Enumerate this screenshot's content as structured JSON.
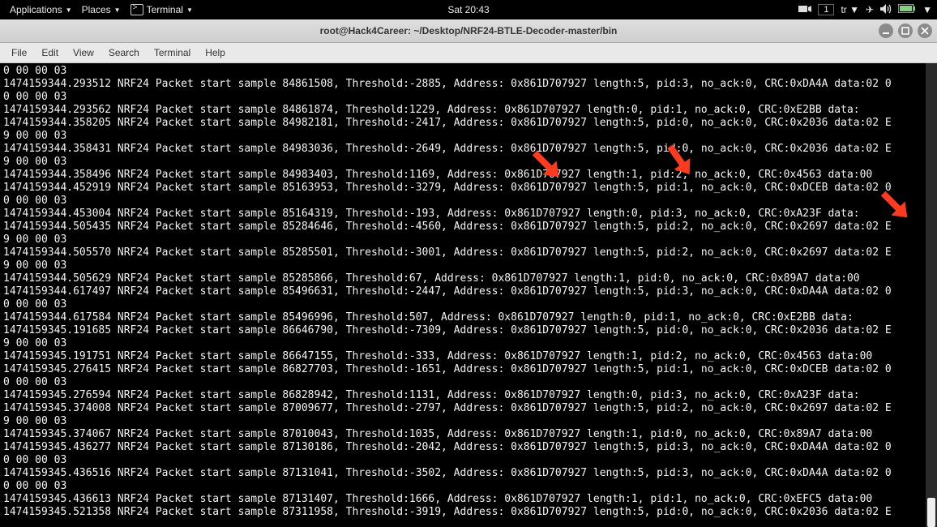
{
  "panel": {
    "applications": "Applications",
    "places": "Places",
    "terminal": "Terminal",
    "clock": "Sat 20:43",
    "workspace": "1",
    "keyboard_layout": "tr"
  },
  "window": {
    "title": "root@Hack4Career: ~/Desktop/NRF24-BTLE-Decoder-master/bin"
  },
  "menubar": {
    "file": "File",
    "edit": "Edit",
    "view": "View",
    "search": "Search",
    "terminal": "Terminal",
    "help": "Help"
  },
  "terminal_lines": [
    "0 00 00 03",
    "1474159344.293512 NRF24 Packet start sample 84861508, Threshold:-2885, Address: 0x861D707927 length:5, pid:3, no_ack:0, CRC:0xDA4A data:02 0",
    "0 00 00 03",
    "1474159344.293562 NRF24 Packet start sample 84861874, Threshold:1229, Address: 0x861D707927 length:0, pid:1, no_ack:0, CRC:0xE2BB data:",
    "1474159344.358205 NRF24 Packet start sample 84982181, Threshold:-2417, Address: 0x861D707927 length:5, pid:0, no_ack:0, CRC:0x2036 data:02 E",
    "9 00 00 03",
    "1474159344.358431 NRF24 Packet start sample 84983036, Threshold:-2649, Address: 0x861D707927 length:5, pid:0, no_ack:0, CRC:0x2036 data:02 E",
    "9 00 00 03",
    "1474159344.358496 NRF24 Packet start sample 84983403, Threshold:1169, Address: 0x861D707927 length:1, pid:2, no_ack:0, CRC:0x4563 data:00",
    "1474159344.452919 NRF24 Packet start sample 85163953, Threshold:-3279, Address: 0x861D707927 length:5, pid:1, no_ack:0, CRC:0xDCEB data:02 0",
    "0 00 00 03",
    "1474159344.453004 NRF24 Packet start sample 85164319, Threshold:-193, Address: 0x861D707927 length:0, pid:3, no_ack:0, CRC:0xA23F data:",
    "1474159344.505435 NRF24 Packet start sample 85284646, Threshold:-4560, Address: 0x861D707927 length:5, pid:2, no_ack:0, CRC:0x2697 data:02 E",
    "9 00 00 03",
    "1474159344.505570 NRF24 Packet start sample 85285501, Threshold:-3001, Address: 0x861D707927 length:5, pid:2, no_ack:0, CRC:0x2697 data:02 E",
    "9 00 00 03",
    "1474159344.505629 NRF24 Packet start sample 85285866, Threshold:67, Address: 0x861D707927 length:1, pid:0, no_ack:0, CRC:0x89A7 data:00",
    "1474159344.617497 NRF24 Packet start sample 85496631, Threshold:-2447, Address: 0x861D707927 length:5, pid:3, no_ack:0, CRC:0xDA4A data:02 0",
    "0 00 00 03",
    "1474159344.617584 NRF24 Packet start sample 85496996, Threshold:507, Address: 0x861D707927 length:0, pid:1, no_ack:0, CRC:0xE2BB data:",
    "1474159345.191685 NRF24 Packet start sample 86646790, Threshold:-7309, Address: 0x861D707927 length:5, pid:0, no_ack:0, CRC:0x2036 data:02 E",
    "9 00 00 03",
    "1474159345.191751 NRF24 Packet start sample 86647155, Threshold:-333, Address: 0x861D707927 length:1, pid:2, no_ack:0, CRC:0x4563 data:00",
    "1474159345.276415 NRF24 Packet start sample 86827703, Threshold:-1651, Address: 0x861D707927 length:5, pid:1, no_ack:0, CRC:0xDCEB data:02 0",
    "0 00 00 03",
    "1474159345.276594 NRF24 Packet start sample 86828942, Threshold:1131, Address: 0x861D707927 length:0, pid:3, no_ack:0, CRC:0xA23F data:",
    "1474159345.374008 NRF24 Packet start sample 87009677, Threshold:-2797, Address: 0x861D707927 length:5, pid:2, no_ack:0, CRC:0x2697 data:02 E",
    "9 00 00 03",
    "1474159345.374067 NRF24 Packet start sample 87010043, Threshold:1035, Address: 0x861D707927 length:1, pid:0, no_ack:0, CRC:0x89A7 data:00",
    "1474159345.436277 NRF24 Packet start sample 87130186, Threshold:-2042, Address: 0x861D707927 length:5, pid:3, no_ack:0, CRC:0xDA4A data:02 0",
    "0 00 00 03",
    "1474159345.436516 NRF24 Packet start sample 87131041, Threshold:-3502, Address: 0x861D707927 length:5, pid:3, no_ack:0, CRC:0xDA4A data:02 0",
    "0 00 00 03",
    "1474159345.436613 NRF24 Packet start sample 87131407, Threshold:1666, Address: 0x861D707927 length:1, pid:1, no_ack:0, CRC:0xEFC5 data:00",
    "1474159345.521358 NRF24 Packet start sample 87311958, Threshold:-3919, Address: 0x861D707927 length:5, pid:0, no_ack:0, CRC:0x2036 data:02 E"
  ]
}
